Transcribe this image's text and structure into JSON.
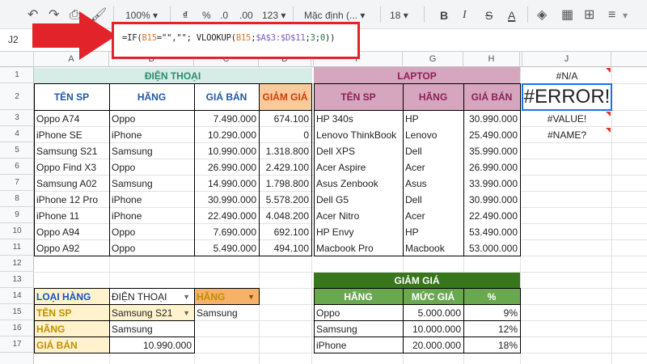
{
  "toolbar": {
    "zoom": "100%",
    "currency": "₫",
    "percent": "%",
    "dec_less": ".0",
    "dec_more": ".00",
    "format_more": "123",
    "font": "Mặc định (...",
    "font_size": "18",
    "bold": "B",
    "italic": "I",
    "strike": "S",
    "text_color": "A"
  },
  "formula_bar": {
    "cell_ref": "J2",
    "fx": "fx",
    "formula_parts": {
      "p1": "=IF(",
      "p2": "B15",
      "p3": "=\"\",\"\"; VLOOKUP(",
      "p4": "B15",
      "p5": ";",
      "p6": "$A$3:$D$11",
      "p7": ";",
      "p8": "3",
      "p9": ";",
      "p10": "0",
      "p11": "))"
    }
  },
  "columns": [
    "A",
    "B",
    "C",
    "D",
    "E",
    "F",
    "G",
    "H",
    "",
    "J"
  ],
  "rows": [
    "1",
    "2",
    "3",
    "4",
    "5",
    "6",
    "7",
    "8",
    "9",
    "10",
    "11",
    "12",
    "13",
    "14",
    "15",
    "16",
    "17"
  ],
  "phone_table": {
    "title": "ĐIỆN THOẠI",
    "headers": [
      "TÊN SP",
      "HÃNG",
      "GIÁ BÁN",
      "GIẢM GIÁ"
    ],
    "rows": [
      [
        "Oppo A74",
        "Oppo",
        "7.490.000",
        "674.100"
      ],
      [
        "iPhone SE",
        "iPhone",
        "10.290.000",
        "0"
      ],
      [
        "Samsung S21",
        "Samsung",
        "10.990.000",
        "1.318.800"
      ],
      [
        "Oppo Find X3",
        "Oppo",
        "26.990.000",
        "2.429.100"
      ],
      [
        "Samsung A02",
        "Samsung",
        "14.990.000",
        "1.798.800"
      ],
      [
        "iPhone 12 Pro",
        "iPhone",
        "30.990.000",
        "5.578.200"
      ],
      [
        "iPhone 11",
        "iPhone",
        "22.490.000",
        "4.048.200"
      ],
      [
        "Oppo A94",
        "Oppo",
        "7.690.000",
        "692.100"
      ],
      [
        "Oppo A92",
        "Oppo",
        "5.490.000",
        "494.100"
      ]
    ]
  },
  "laptop_table": {
    "title": "LAPTOP",
    "headers": [
      "TÊN SP",
      "HÃNG",
      "GIÁ BÁN"
    ],
    "rows": [
      [
        "HP 340s",
        "HP",
        "30.990.000"
      ],
      [
        "Lenovo ThinkBook",
        "Lenovo",
        "25.490.000"
      ],
      [
        "Dell XPS",
        "Dell",
        "35.990.000"
      ],
      [
        "Acer Aspire",
        "Acer",
        "26.990.000"
      ],
      [
        "Asus Zenbook",
        "Asus",
        "33.990.000"
      ],
      [
        "Dell G5",
        "Dell",
        "30.990.000"
      ],
      [
        "Acer Nitro",
        "Acer",
        "22.490.000"
      ],
      [
        "HP Envy",
        "HP",
        "53.490.000"
      ],
      [
        "Macbook Pro",
        "Macbook",
        "53.000.000"
      ]
    ]
  },
  "errors": [
    "#N/A",
    "#ERROR!",
    "#VALUE!",
    "#NAME?"
  ],
  "lookup": {
    "type_label": "LOẠI HÀNG",
    "type_value": "ĐIỆN THOẠI",
    "brand_label_right": "HÃNG",
    "brand_value_right": "Samsung",
    "name_label": "TÊN SP",
    "name_value": "Samsung S21",
    "brand_label": "HÃNG",
    "brand_value": "Samsung",
    "price_label": "GIÁ BÁN",
    "price_value": "10.990.000"
  },
  "discount_table": {
    "title": "GIẢM GIÁ",
    "headers": [
      "HÃNG",
      "MỨC GIÁ",
      "%"
    ],
    "rows": [
      [
        "Oppo",
        "5.000.000",
        "9%"
      ],
      [
        "Samsung",
        "10.000.000",
        "12%"
      ],
      [
        "iPhone",
        "20.000.000",
        "18%"
      ]
    ]
  },
  "colors": {
    "phone_title_bg": "#d7ebe7",
    "phone_title_fg": "#2a8c6d",
    "phone_hdr_fg": "#1f57a6",
    "discount_hdr_bg": "#f9ca9c",
    "discount_hdr_fg": "#d03d0a",
    "laptop_bg": "#d5a6bd",
    "laptop_fg": "#8d1f57",
    "discount_table_bg": "#38761d",
    "discount_head_bg": "#6aa84f",
    "lookup_label_bg": "#fff2cc",
    "lookup_type_fg": "#1155cc",
    "lookup_label_fg": "#bf9000",
    "arrow": "#e3232a"
  }
}
